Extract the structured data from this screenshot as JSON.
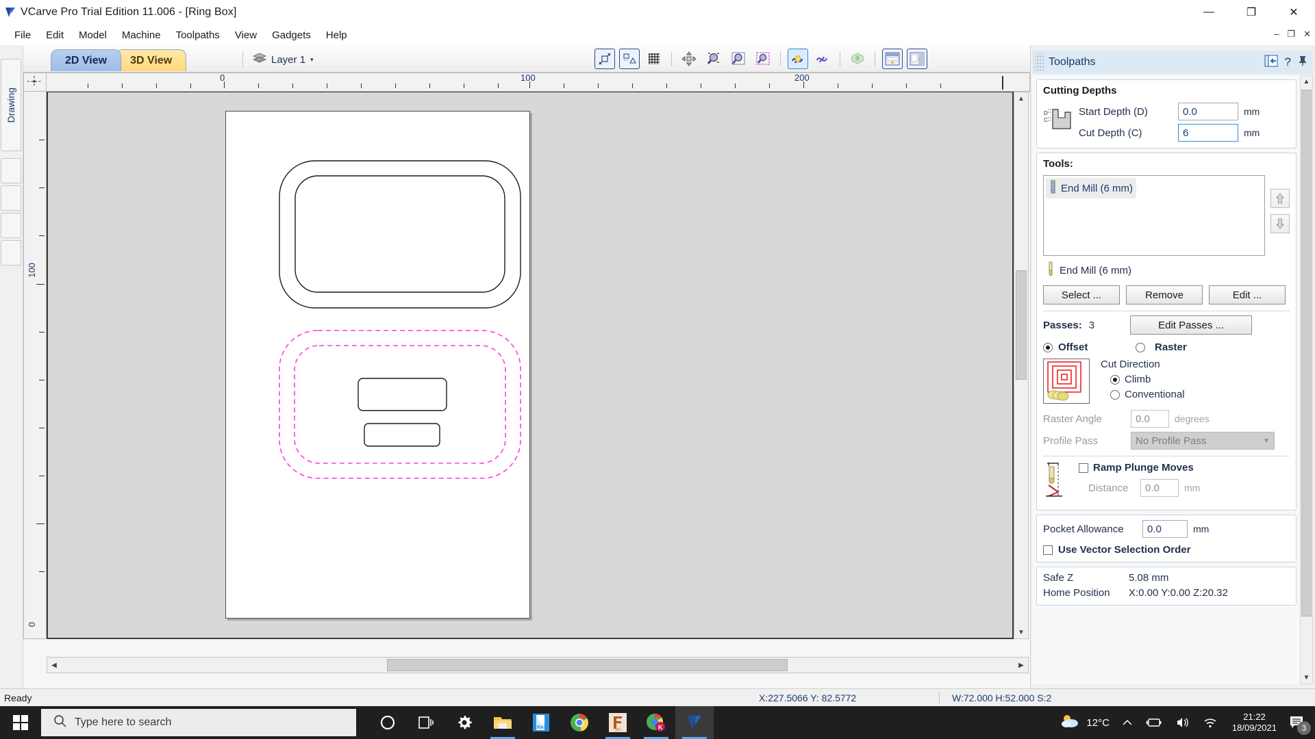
{
  "window": {
    "title": "VCarve Pro Trial Edition 11.006 - [Ring Box]",
    "logo_icon": "vcarve-logo-icon",
    "minimize": "—",
    "maximize": "❐",
    "close": "✕",
    "inner_minimize": "–",
    "inner_restore": "❐",
    "inner_close": "✕"
  },
  "menu": {
    "items": [
      {
        "label": "File"
      },
      {
        "label": "Edit"
      },
      {
        "label": "Model"
      },
      {
        "label": "Machine"
      },
      {
        "label": "Toolpaths"
      },
      {
        "label": "View"
      },
      {
        "label": "Gadgets"
      },
      {
        "label": "Help"
      }
    ]
  },
  "left_strip": {
    "tab_label": "Drawing"
  },
  "view_tabs": [
    {
      "label": "2D View",
      "active": true
    },
    {
      "label": "3D View",
      "active": false
    }
  ],
  "layer": {
    "name": "Layer 1",
    "icon": "layers-icon",
    "caret": "▾"
  },
  "toolbar_icons": [
    {
      "name": "scale-object-icon",
      "framed": true
    },
    {
      "name": "align-objects-icon",
      "framed": true
    },
    {
      "name": "grid-snap-icon",
      "framed": false
    },
    {
      "name": "pan-view-icon",
      "framed": false
    },
    {
      "name": "zoom-window-icon",
      "framed": false
    },
    {
      "name": "zoom-extents-icon",
      "framed": false
    },
    {
      "name": "zoom-selection-icon",
      "framed": false
    },
    {
      "name": "toggle-toolpath-icon",
      "selected": true
    },
    {
      "name": "toolpath-preview-icon",
      "framed": false
    },
    {
      "name": "3d-model-icon",
      "framed": false
    },
    {
      "name": "panel-bottom-icon",
      "framed": true
    },
    {
      "name": "panel-right-icon",
      "framed": true
    }
  ],
  "rulers": {
    "horizontal_labels": [
      "0",
      "100",
      "200"
    ],
    "vertical_labels": [
      "100",
      "0"
    ]
  },
  "panel": {
    "title": "Toolpaths",
    "dock_icon": "dock-left-icon",
    "help_icon": "help-icon",
    "pin_icon": "pin-icon",
    "cutting_depths": {
      "title": "Cutting Depths",
      "diagram_icon": "cut-depth-diagram-icon",
      "start_depth_label": "Start Depth (D)",
      "start_depth_value": "0.0",
      "start_depth_unit": "mm",
      "cut_depth_label": "Cut Depth (C)",
      "cut_depth_value": "6",
      "cut_depth_unit": "mm"
    },
    "tools": {
      "title": "Tools:",
      "list": [
        {
          "label": "End Mill (6 mm)",
          "icon": "endmill-icon",
          "selected": true
        }
      ],
      "move_up_icon": "arrow-up-icon",
      "move_down_icon": "arrow-down-icon",
      "current_tool": "End Mill (6 mm)",
      "current_tool_icon": "endmill-bit-icon",
      "select_btn": "Select ...",
      "remove_btn": "Remove",
      "edit_btn": "Edit ..."
    },
    "strategy": {
      "passes_label": "Passes:",
      "passes_value": "3",
      "edit_passes_btn": "Edit Passes ...",
      "offset_label": "Offset",
      "offset_selected": true,
      "raster_label": "Raster",
      "raster_selected": false,
      "preview_icon": "offset-pattern-icon",
      "cut_direction_label": "Cut Direction",
      "climb_label": "Climb",
      "climb_selected": true,
      "conventional_label": "Conventional",
      "conventional_selected": false,
      "raster_angle_label": "Raster Angle",
      "raster_angle_value": "0.0",
      "raster_angle_unit": "degrees",
      "profile_pass_label": "Profile Pass",
      "profile_pass_value": "No Profile Pass",
      "ramp_icon": "ramp-plunge-icon",
      "ramp_label": "Ramp Plunge Moves",
      "ramp_checked": false,
      "distance_label": "Distance",
      "distance_value": "0.0",
      "distance_unit": "mm"
    },
    "pocket": {
      "allowance_label": "Pocket Allowance",
      "allowance_value": "0.0",
      "allowance_unit": "mm",
      "vector_order_label": "Use Vector Selection Order",
      "vector_order_checked": false
    },
    "position": {
      "safe_z_label": "Safe Z",
      "safe_z_value": "5.08 mm",
      "home_label": "Home Position",
      "home_value": "X:0.00 Y:0.00 Z:20.32"
    }
  },
  "status": {
    "ready": "Ready",
    "coords": "X:227.5066 Y: 82.5772",
    "dims": "W:72.000   H:52.000   S:2"
  },
  "taskbar": {
    "start_icon": "windows-start-icon",
    "search_icon": "search-icon",
    "search_placeholder": "Type here to search",
    "apps": [
      {
        "name": "cortana-icon",
        "active": false,
        "underline": false
      },
      {
        "name": "task-view-icon",
        "active": false,
        "underline": false
      },
      {
        "name": "settings-gear-icon",
        "active": false,
        "underline": false
      },
      {
        "name": "file-explorer-icon",
        "active": false,
        "underline": true
      },
      {
        "name": "winrar-icon",
        "active": false,
        "underline": false
      },
      {
        "name": "chrome-icon",
        "active": false,
        "underline": false
      },
      {
        "name": "fusion360-icon",
        "active": false,
        "underline": true
      },
      {
        "name": "kiwi-browser-icon",
        "active": false,
        "underline": true
      },
      {
        "name": "vcarve-icon",
        "active": true,
        "underline": true
      }
    ],
    "weather_icon": "partly-cloudy-icon",
    "temperature": "12°C",
    "chevron_icon": "chevron-up-icon",
    "battery_icon": "battery-charging-icon",
    "volume_icon": "speaker-icon",
    "wifi_icon": "wifi-icon",
    "time": "21:22",
    "date": "18/09/2021",
    "notification_icon": "notifications-icon",
    "notification_count": "3"
  },
  "colors": {
    "accent_blue": "#2f8ada",
    "toolpath_magenta": "#ff3ce0",
    "panel_header": "#dceaf6",
    "tab_active": "#9cbce8",
    "tab_inactive": "#ffd978"
  }
}
